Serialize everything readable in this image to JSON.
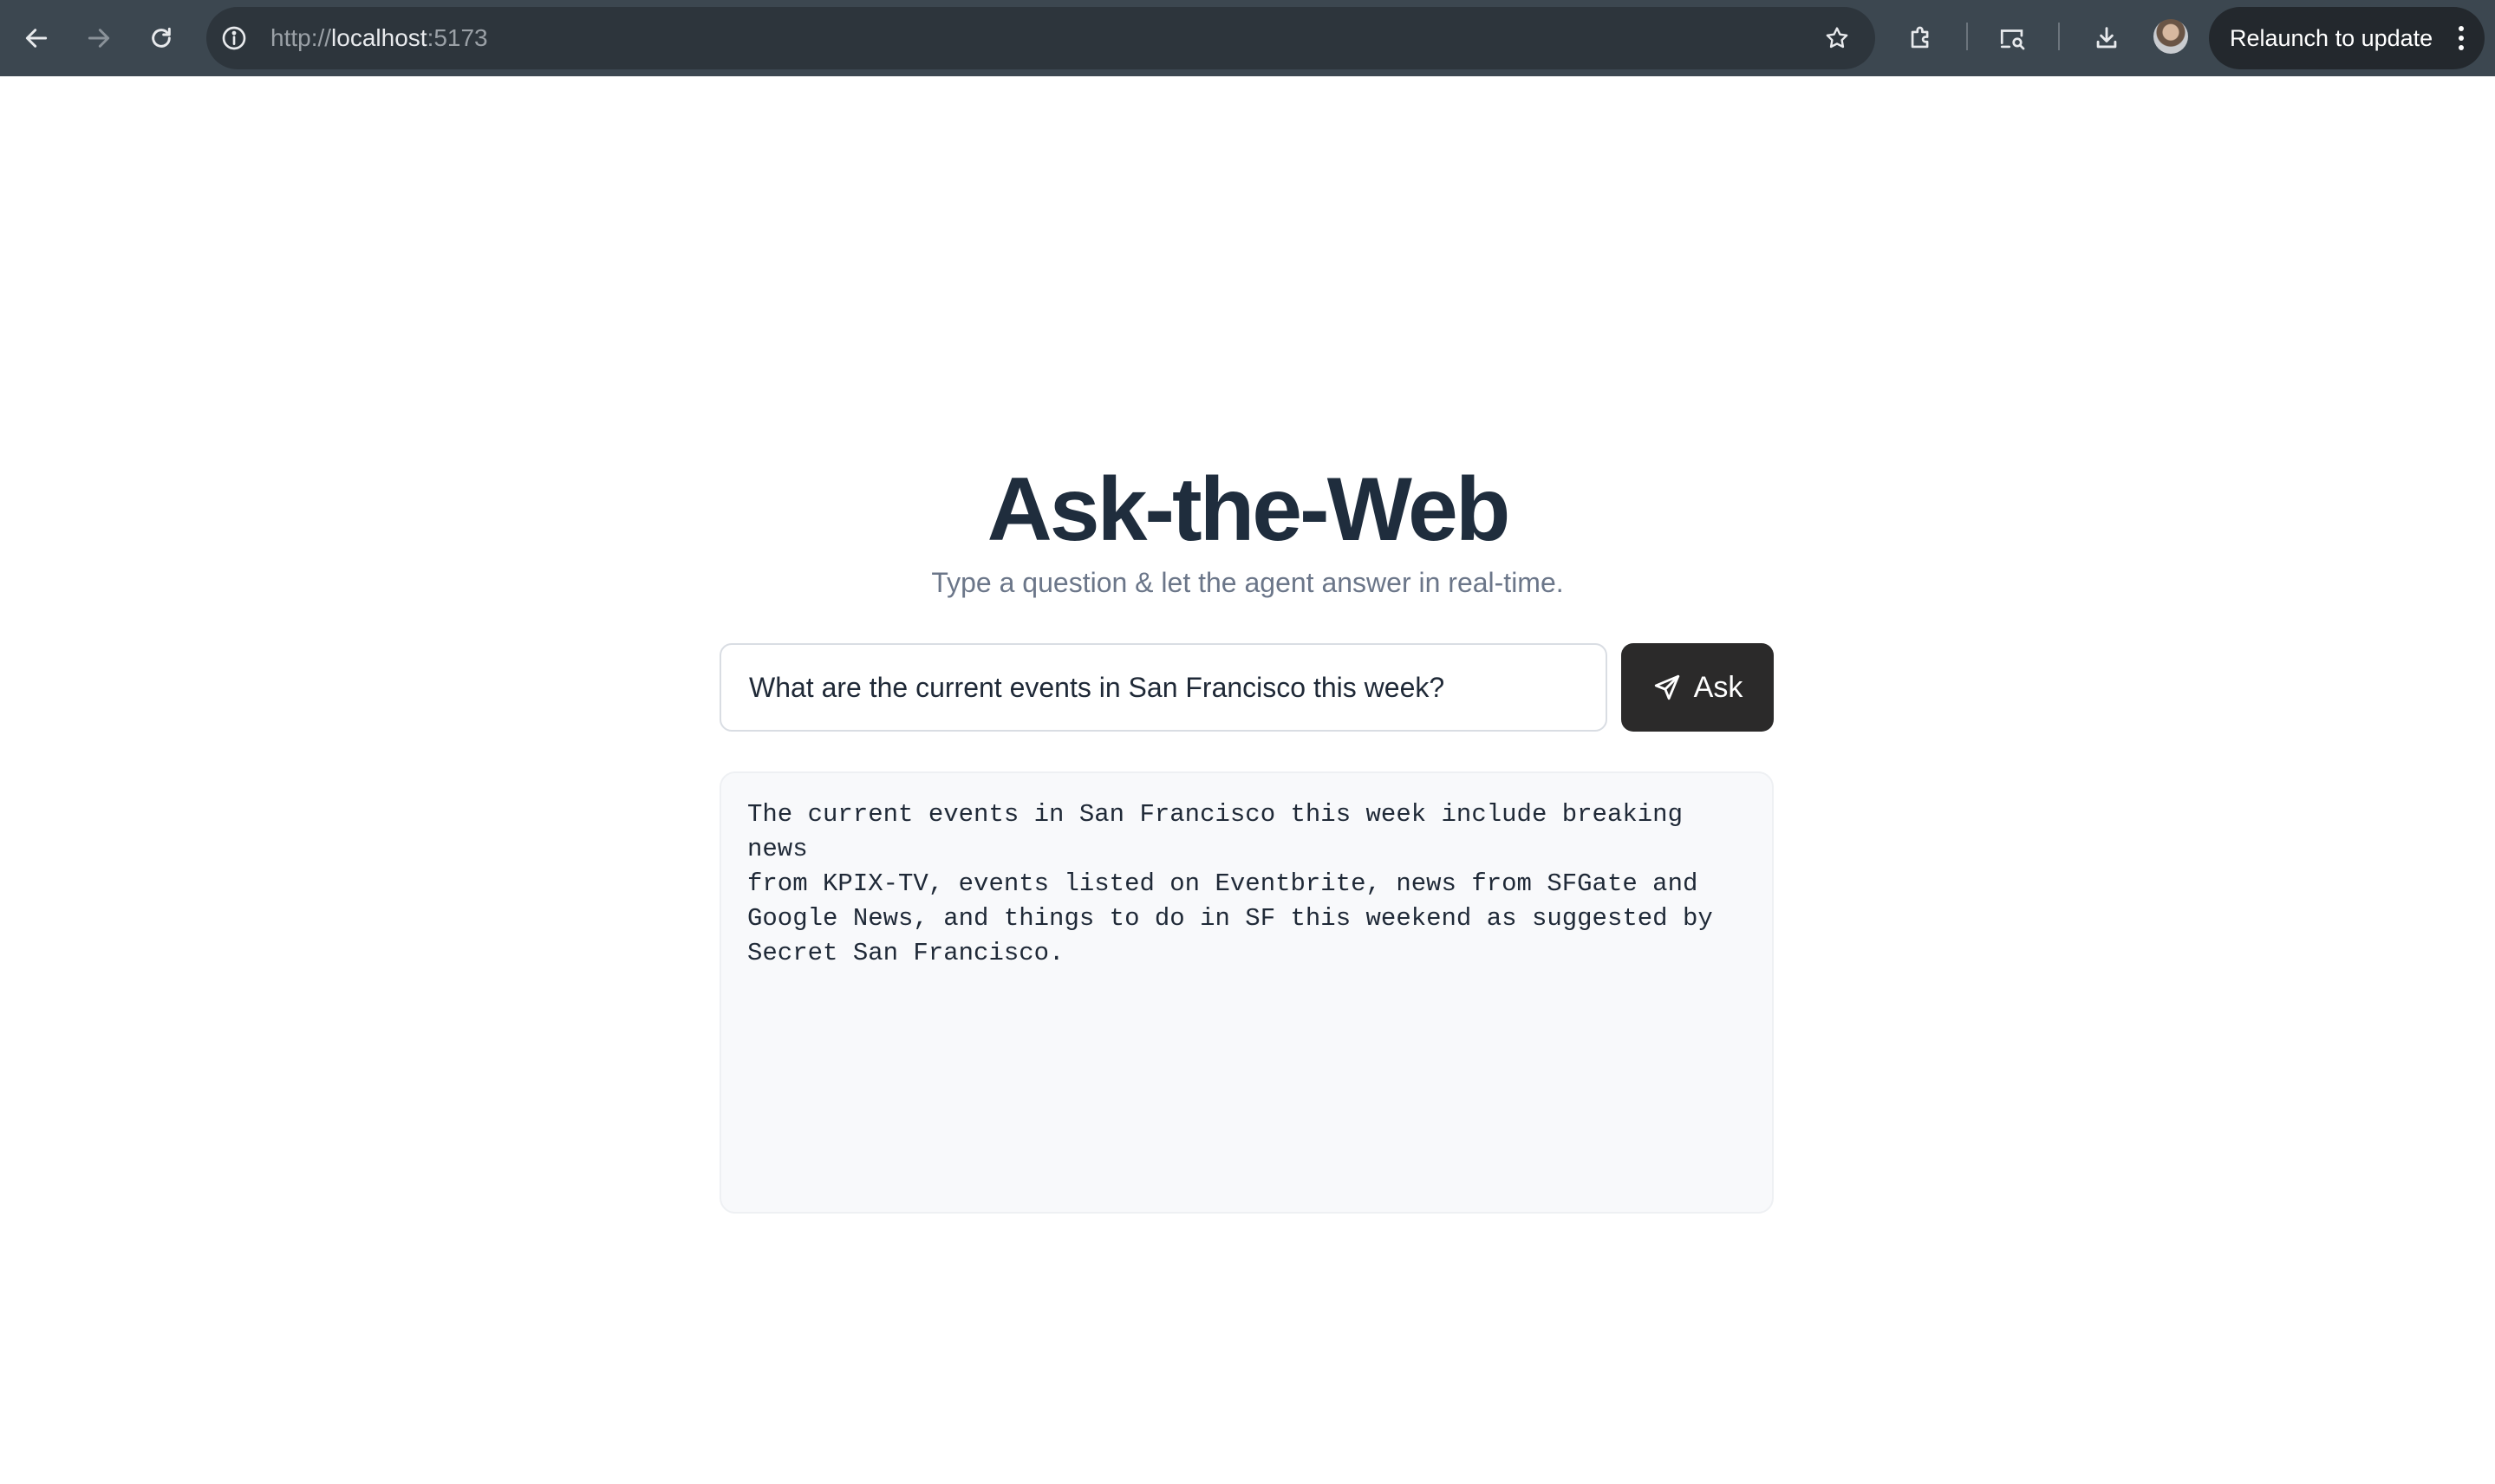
{
  "browser": {
    "url_scheme": "http://",
    "url_host": "localhost",
    "url_port": ":5173",
    "relaunch_label": "Relaunch to update",
    "icons": {
      "back": "arrow-left-icon",
      "forward": "arrow-right-icon",
      "reload": "reload-icon",
      "site_info": "info-icon",
      "bookmark": "star-icon",
      "extensions": "puzzle-icon",
      "cast": "cast-search-icon",
      "downloads": "download-icon",
      "menu": "kebab-icon"
    }
  },
  "app": {
    "title": "Ask-the-Web",
    "subtitle": "Type a question & let the agent answer in real-time.",
    "query_value": "What are the current events in San Francisco this week?",
    "ask_label": "Ask",
    "answer": "The current events in San Francisco this week include breaking news\nfrom KPIX-TV, events listed on Eventbrite, news from SFGate and\nGoogle News, and things to do in SF this weekend as suggested by\nSecret San Francisco."
  },
  "colors": {
    "chrome_bg": "#3c4750",
    "omnibox_bg": "#2d353c",
    "title": "#1f2d3d",
    "subtitle": "#6b7689",
    "ask_button_bg": "#2b2a2a",
    "answer_bg": "#f8f9fb"
  }
}
